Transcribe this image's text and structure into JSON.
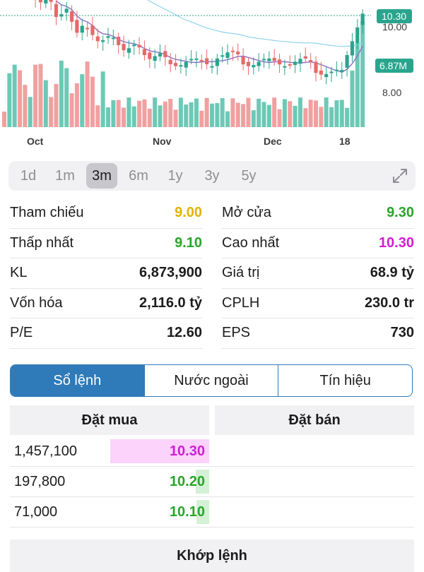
{
  "chart_data": {
    "type": "candlestick",
    "y_ticks": [
      "10.00",
      "8.00"
    ],
    "x_labels": [
      "Oct",
      "Nov",
      "Dec",
      "18"
    ],
    "last_price_label": "10.30",
    "volume_label": "6.87M",
    "colors": {
      "up": "#2aa58d",
      "down": "#e66a6a",
      "up_volume": "#6cc9b6",
      "down_volume": "#f0a0a0",
      "ma_short": "#8e6cc7",
      "ma_long": "#8fd3ee",
      "price_tag": "#2aa58d"
    }
  },
  "range_tabs": {
    "items": [
      {
        "label": "1d",
        "active": false
      },
      {
        "label": "1m",
        "active": false
      },
      {
        "label": "3m",
        "active": true
      },
      {
        "label": "6m",
        "active": false
      },
      {
        "label": "1y",
        "active": false
      },
      {
        "label": "3y",
        "active": false
      },
      {
        "label": "5y",
        "active": false
      }
    ],
    "expand_icon": "expand-arrows-icon"
  },
  "stats": {
    "rows": [
      [
        {
          "label": "Tham chiếu",
          "value": "9.00",
          "color": "#e0b400"
        },
        {
          "label": "Mở cửa",
          "value": "9.30",
          "color": "#2aa52a"
        }
      ],
      [
        {
          "label": "Thấp nhất",
          "value": "9.10",
          "color": "#2aa52a"
        },
        {
          "label": "Cao nhất",
          "value": "10.30",
          "color": "#d21ed2"
        }
      ],
      [
        {
          "label": "KL",
          "value": "6,873,900",
          "color": "#1c1c1e"
        },
        {
          "label": "Giá trị",
          "value": "68.9 tỷ",
          "color": "#1c1c1e"
        }
      ],
      [
        {
          "label": "Vốn hóa",
          "value": "2,116.0 tỷ",
          "color": "#1c1c1e"
        },
        {
          "label": "CPLH",
          "value": "230.0 tr",
          "color": "#1c1c1e"
        }
      ],
      [
        {
          "label": "P/E",
          "value": "12.60",
          "color": "#1c1c1e"
        },
        {
          "label": "EPS",
          "value": "730",
          "color": "#1c1c1e"
        }
      ]
    ]
  },
  "segments": [
    "Sổ lệnh",
    "Nước ngoài",
    "Tín hiệu"
  ],
  "order_book": {
    "buy_header": "Đặt mua",
    "sell_header": "Đặt bán",
    "rows": [
      {
        "qty": "1,457,100",
        "price": "10.30",
        "color": "#d21ed2",
        "bar_color": "#fbd3fb",
        "share": 1.0
      },
      {
        "qty": "197,800",
        "price": "10.20",
        "color": "#2aa52a",
        "bar_color": "#d5f1d5",
        "share": 0.136
      },
      {
        "qty": "71,000",
        "price": "10.10",
        "color": "#2aa52a",
        "bar_color": "#d5f1d5",
        "share": 0.049
      }
    ]
  },
  "match_header": "Khớp lệnh"
}
